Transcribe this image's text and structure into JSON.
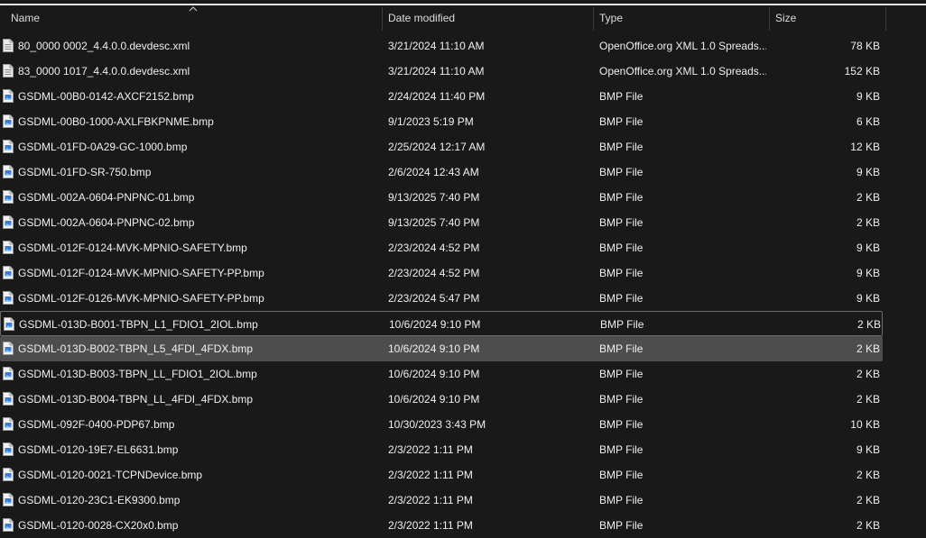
{
  "columns": {
    "name": "Name",
    "date": "Date modified",
    "type": "Type",
    "size": "Size"
  },
  "files": [
    {
      "name": "80_0000 0002_4.4.0.0.devdesc.xml",
      "date": "3/21/2024 11:10 AM",
      "type": "OpenOffice.org XML 1.0 Spreads...",
      "size": "78 KB",
      "icon": "xml-file-icon"
    },
    {
      "name": "83_0000 1017_4.4.0.0.devdesc.xml",
      "date": "3/21/2024 11:10 AM",
      "type": "OpenOffice.org XML 1.0 Spreads...",
      "size": "152 KB",
      "icon": "xml-file-icon"
    },
    {
      "name": "GSDML-00B0-0142-AXCF2152.bmp",
      "date": "2/24/2024 11:40 PM",
      "type": "BMP File",
      "size": "9 KB",
      "icon": "bmp-file-icon"
    },
    {
      "name": "GSDML-00B0-1000-AXLFBKPNME.bmp",
      "date": "9/1/2023 5:19 PM",
      "type": "BMP File",
      "size": "6 KB",
      "icon": "bmp-file-icon"
    },
    {
      "name": "GSDML-01FD-0A29-GC-1000.bmp",
      "date": "2/25/2024 12:17 AM",
      "type": "BMP File",
      "size": "12 KB",
      "icon": "bmp-file-icon"
    },
    {
      "name": "GSDML-01FD-SR-750.bmp",
      "date": "2/6/2024 12:43 AM",
      "type": "BMP File",
      "size": "9 KB",
      "icon": "bmp-file-icon"
    },
    {
      "name": "GSDML-002A-0604-PNPNC-01.bmp",
      "date": "9/13/2025 7:40 PM",
      "type": "BMP File",
      "size": "2 KB",
      "icon": "bmp-file-icon"
    },
    {
      "name": "GSDML-002A-0604-PNPNC-02.bmp",
      "date": "9/13/2025 7:40 PM",
      "type": "BMP File",
      "size": "2 KB",
      "icon": "bmp-file-icon"
    },
    {
      "name": "GSDML-012F-0124-MVK-MPNIO-SAFETY.bmp",
      "date": "2/23/2024 4:52 PM",
      "type": "BMP File",
      "size": "9 KB",
      "icon": "bmp-file-icon"
    },
    {
      "name": "GSDML-012F-0124-MVK-MPNIO-SAFETY-PP.bmp",
      "date": "2/23/2024 4:52 PM",
      "type": "BMP File",
      "size": "9 KB",
      "icon": "bmp-file-icon"
    },
    {
      "name": "GSDML-012F-0126-MVK-MPNIO-SAFETY-PP.bmp",
      "date": "2/23/2024 5:47 PM",
      "type": "BMP File",
      "size": "9 KB",
      "icon": "bmp-file-icon"
    },
    {
      "name": "GSDML-013D-B001-TBPN_L1_FDIO1_2IOL.bmp",
      "date": "10/6/2024 9:10 PM",
      "type": "BMP File",
      "size": "2 KB",
      "icon": "bmp-file-icon",
      "state": "focused"
    },
    {
      "name": "GSDML-013D-B002-TBPN_L5_4FDI_4FDX.bmp",
      "date": "10/6/2024 9:10 PM",
      "type": "BMP File",
      "size": "2 KB",
      "icon": "bmp-file-icon",
      "state": "selected"
    },
    {
      "name": "GSDML-013D-B003-TBPN_LL_FDIO1_2IOL.bmp",
      "date": "10/6/2024 9:10 PM",
      "type": "BMP File",
      "size": "2 KB",
      "icon": "bmp-file-icon"
    },
    {
      "name": "GSDML-013D-B004-TBPN_LL_4FDI_4FDX.bmp",
      "date": "10/6/2024 9:10 PM",
      "type": "BMP File",
      "size": "2 KB",
      "icon": "bmp-file-icon"
    },
    {
      "name": "GSDML-092F-0400-PDP67.bmp",
      "date": "10/30/2023 3:43 PM",
      "type": "BMP File",
      "size": "10 KB",
      "icon": "bmp-file-icon"
    },
    {
      "name": "GSDML-0120-19E7-EL6631.bmp",
      "date": "2/3/2022 1:11 PM",
      "type": "BMP File",
      "size": "9 KB",
      "icon": "bmp-file-icon"
    },
    {
      "name": "GSDML-0120-0021-TCPNDevice.bmp",
      "date": "2/3/2022 1:11 PM",
      "type": "BMP File",
      "size": "2 KB",
      "icon": "bmp-file-icon"
    },
    {
      "name": "GSDML-0120-23C1-EK9300.bmp",
      "date": "2/3/2022 1:11 PM",
      "type": "BMP File",
      "size": "2 KB",
      "icon": "bmp-file-icon"
    },
    {
      "name": "GSDML-0120-0028-CX20x0.bmp",
      "date": "2/3/2022 1:11 PM",
      "type": "BMP File",
      "size": "2 KB",
      "icon": "bmp-file-icon"
    }
  ]
}
